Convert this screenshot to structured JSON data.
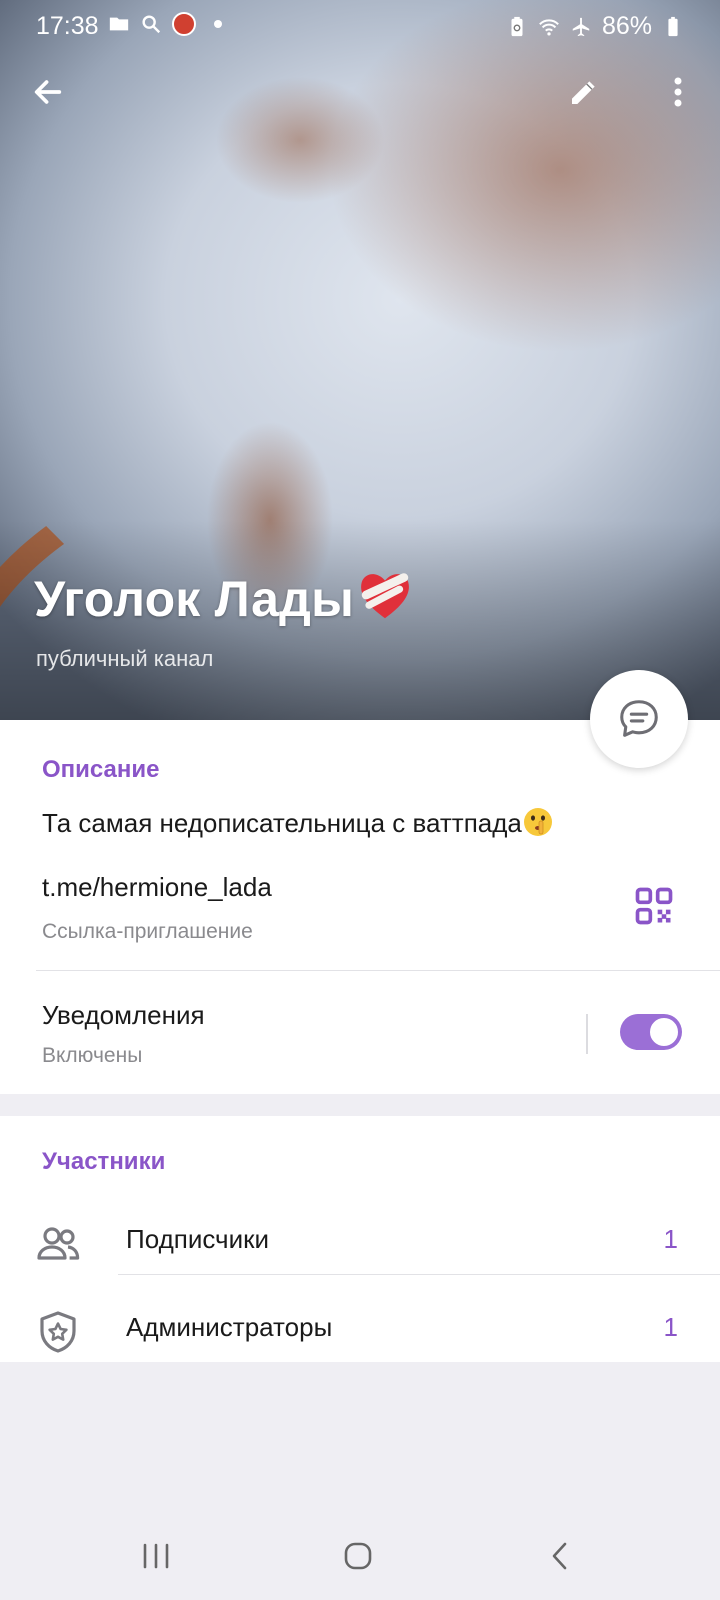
{
  "status_bar": {
    "time": "17:38",
    "battery": "86%",
    "left_icons": [
      "folder-icon",
      "search-icon",
      "app-avatar-icon",
      "notification-dot"
    ],
    "right_icons": [
      "battery-saver-icon",
      "wifi-icon",
      "airplane-icon",
      "battery-icon"
    ]
  },
  "header": {
    "channel_name": "Уголок Лады",
    "channel_type": "публичный канал",
    "title_emoji": "mending-heart-emoji",
    "actions": [
      "back-icon",
      "edit-icon",
      "more-icon"
    ]
  },
  "info": {
    "description_label": "Описание",
    "description_text": "Та самая недописательница с ваттпада",
    "description_emoji": "shushing-face-emoji",
    "link": "t.me/hermione_lada",
    "link_caption": "Ссылка-приглашение",
    "notifications_title": "Уведомления",
    "notifications_status": "Включены",
    "notifications_enabled": true
  },
  "members": {
    "section_label": "Участники",
    "items": [
      {
        "label": "Подписчики",
        "count": "1",
        "icon": "people-icon"
      },
      {
        "label": "Администраторы",
        "count": "1",
        "icon": "shield-star-icon"
      }
    ]
  },
  "colors": {
    "accent": "#8a55c8",
    "toggle_on": "#9b6fd6",
    "background": "#efeef3"
  }
}
